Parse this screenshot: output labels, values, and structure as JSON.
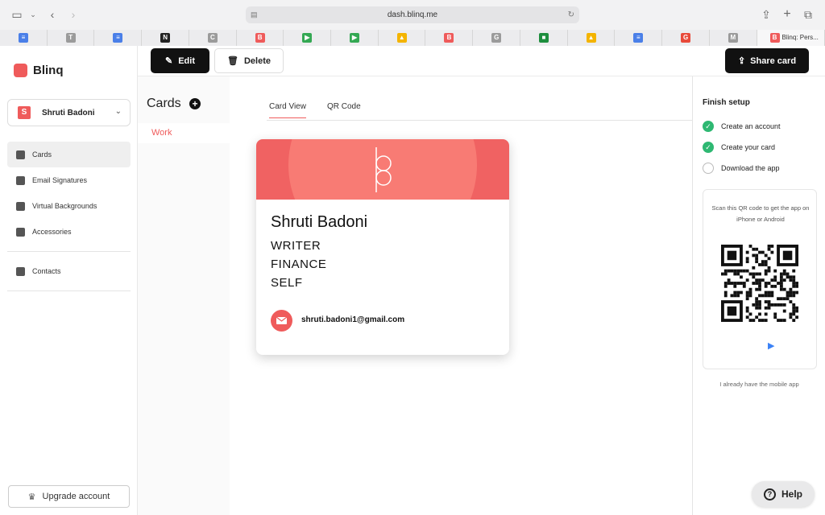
{
  "browser": {
    "url": "dash.blinq.me",
    "active_tab_label": "Blinq: Pers...",
    "tab_favicons": [
      {
        "icon": "docs-icon",
        "color": "#4a7fe8",
        "letter": "≡"
      },
      {
        "icon": "t-icon",
        "color": "#9b9b9b",
        "letter": "T"
      },
      {
        "icon": "docs-icon",
        "color": "#4a7fe8",
        "letter": "≡"
      },
      {
        "icon": "notion-icon",
        "color": "#222222",
        "letter": "N"
      },
      {
        "icon": "c-icon",
        "color": "#9b9b9b",
        "letter": "C"
      },
      {
        "icon": "blinq-icon",
        "color": "#ef5b5b",
        "letter": "B"
      },
      {
        "icon": "meet-icon",
        "color": "#34a853",
        "letter": "▶"
      },
      {
        "icon": "meet-icon",
        "color": "#34a853",
        "letter": "▶"
      },
      {
        "icon": "drive-icon",
        "color": "#f4b400",
        "letter": "▲"
      },
      {
        "icon": "blinq-icon",
        "color": "#ef5b5b",
        "letter": "B"
      },
      {
        "icon": "g-icon",
        "color": "#9b9b9b",
        "letter": "G"
      },
      {
        "icon": "classroom-icon",
        "color": "#1e8e3e",
        "letter": "■"
      },
      {
        "icon": "drive-icon",
        "color": "#f4b400",
        "letter": "▲"
      },
      {
        "icon": "docs-icon",
        "color": "#4a7fe8",
        "letter": "≡"
      },
      {
        "icon": "grammarly-icon",
        "color": "#e84a3a",
        "letter": "G"
      },
      {
        "icon": "m-icon",
        "color": "#9b9b9b",
        "letter": "M"
      }
    ]
  },
  "sidebar": {
    "brand": "Blinq",
    "profile_name": "Shruti Badoni",
    "profile_initial": "S",
    "nav": [
      {
        "label": "Cards",
        "icon": "card-icon",
        "active": true
      },
      {
        "label": "Email Signatures",
        "icon": "mail-icon",
        "active": false
      },
      {
        "label": "Virtual Backgrounds",
        "icon": "image-icon",
        "active": false
      },
      {
        "label": "Accessories",
        "icon": "bag-icon",
        "active": false
      }
    ],
    "contacts_label": "Contacts",
    "upgrade_label": "Upgrade account"
  },
  "actions": {
    "edit": "Edit",
    "delete": "Delete",
    "share": "Share card"
  },
  "cards_panel": {
    "title": "Cards",
    "add_symbol": "+",
    "items": [
      "Work"
    ]
  },
  "view_tabs": {
    "card_view": "Card View",
    "qr_code": "QR Code"
  },
  "card": {
    "name": "Shruti Badoni",
    "lines": [
      "WRITER",
      "FINANCE",
      "SELF"
    ],
    "email": "shruti.badoni1@gmail.com",
    "accent_color": "#ef5b5b"
  },
  "setup": {
    "title": "Finish setup",
    "steps": [
      {
        "label": "Create an account",
        "done": true
      },
      {
        "label": "Create your card",
        "done": true
      },
      {
        "label": "Download the app",
        "done": false
      }
    ],
    "qr_text": "Scan this QR code to get the app on iPhone or Android",
    "already_text": "I already have the mobile app"
  },
  "help": "Help"
}
